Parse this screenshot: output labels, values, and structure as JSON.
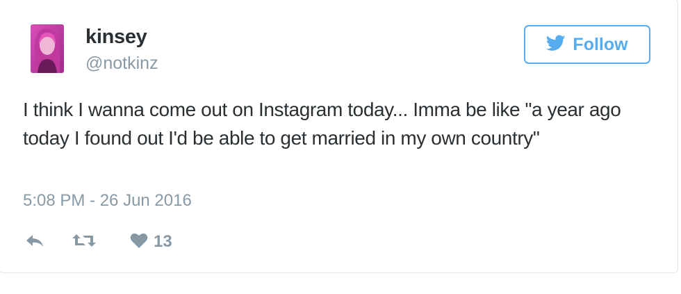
{
  "tweet": {
    "author": {
      "name": "kinsey",
      "handle": "@notkinz",
      "avatar": "profile-photo"
    },
    "follow_button": {
      "label": "Follow",
      "icon": "twitter-bird-icon"
    },
    "text": "I think I wanna come out on Instagram today... Imma be like \"a year ago today I found out I'd be able to get married in my own country\"",
    "timestamp": "5:08 PM - 26 Jun 2016",
    "actions": {
      "reply_icon": "reply-icon",
      "retweet_icon": "retweet-icon",
      "like_icon": "heart-icon",
      "like_count": "13"
    }
  },
  "colors": {
    "accent": "#55acee",
    "text": "#292f33",
    "secondary_text": "#8899a6",
    "border": "#e1e8ed"
  }
}
